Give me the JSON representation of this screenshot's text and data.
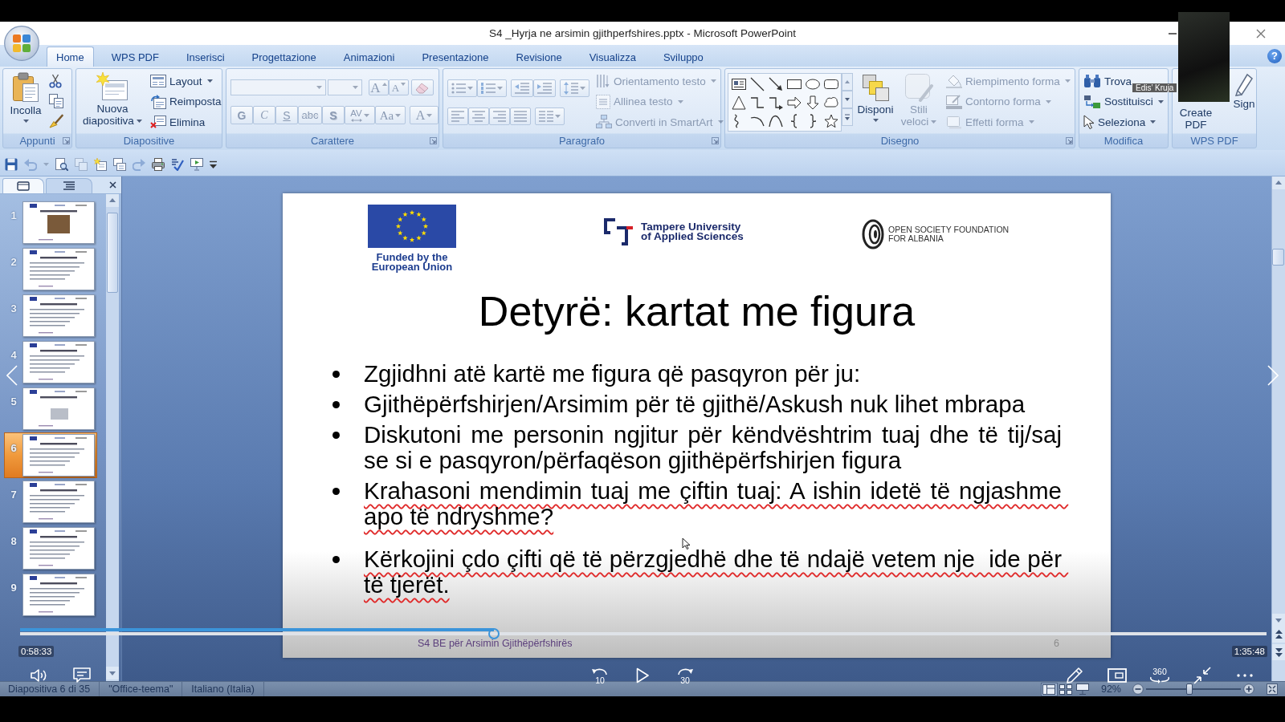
{
  "window": {
    "title": "S4 _Hyrja ne arsimin gjithperfshires.pptx - Microsoft PowerPoint"
  },
  "ribbon_tabs": [
    {
      "label": "Home",
      "selected": true
    },
    {
      "label": "WPS PDF",
      "selected": false
    },
    {
      "label": "Inserisci",
      "selected": false
    },
    {
      "label": "Progettazione",
      "selected": false
    },
    {
      "label": "Animazioni",
      "selected": false
    },
    {
      "label": "Presentazione",
      "selected": false
    },
    {
      "label": "Revisione",
      "selected": false
    },
    {
      "label": "Visualizza",
      "selected": false
    },
    {
      "label": "Sviluppo",
      "selected": false
    }
  ],
  "help_button": "?",
  "ribbon_groups": [
    {
      "label": "Appunti",
      "launcher": true,
      "disabled": false,
      "large_button": {
        "label": "Incolla",
        "dropdown": true
      }
    },
    {
      "label": "Diapositive",
      "launcher": false,
      "disabled": false,
      "large_button": {
        "label": "Nuova diapositiva",
        "dropdown": true
      },
      "buttons": [
        {
          "label": "Layout",
          "dropdown": true
        },
        {
          "label": "Reimposta",
          "dropdown": false
        },
        {
          "label": "Elimina",
          "dropdown": false
        }
      ]
    },
    {
      "label": "Carattere",
      "launcher": true,
      "disabled": true,
      "size_buttons": [
        {
          "label": "A",
          "kind": "grow"
        },
        {
          "label": "A",
          "kind": "shrink"
        }
      ],
      "format_buttons": [
        {
          "label": "G",
          "kind": "bold",
          "dropdown": false
        },
        {
          "label": "C",
          "kind": "italic",
          "dropdown": false
        },
        {
          "label": "S",
          "kind": "underline",
          "dropdown": false
        },
        {
          "label": "abc",
          "kind": "strikethrough",
          "dropdown": false
        },
        {
          "label": "S",
          "kind": "shadow",
          "dropdown": false
        },
        {
          "label": "AV",
          "kind": "spacing",
          "dropdown": true
        },
        {
          "label": "Aa",
          "kind": "case",
          "dropdown": true
        }
      ],
      "color_button": {
        "label": "A",
        "dropdown": true
      }
    },
    {
      "label": "Paragrafo",
      "launcher": true,
      "disabled": true,
      "buttons": [
        {
          "label": "Orientamento testo",
          "dropdown": true
        },
        {
          "label": "Allinea testo",
          "dropdown": true
        },
        {
          "label": "Converti in SmartArt",
          "dropdown": true
        }
      ]
    },
    {
      "label": "Disegno",
      "launcher": true,
      "disabled": false,
      "large_buttons": [
        {
          "label": "Disponi",
          "dropdown": true,
          "disabled": false
        },
        {
          "label": "Stili veloci",
          "dropdown": true,
          "disabled": true
        }
      ],
      "buttons": [
        {
          "label": "Riempimento forma",
          "dropdown": true,
          "disabled": true
        },
        {
          "label": "Contorno forma",
          "dropdown": true,
          "disabled": true
        },
        {
          "label": "Effetti forma",
          "dropdown": true,
          "disabled": true
        }
      ]
    },
    {
      "label": "Modifica",
      "launcher": false,
      "disabled": false,
      "buttons": [
        {
          "label": "Trova",
          "dropdown": false
        },
        {
          "label": "Sostituisci",
          "dropdown": true
        },
        {
          "label": "Seleziona",
          "dropdown": true
        }
      ]
    },
    {
      "label": "WPS PDF",
      "launcher": false,
      "disabled": false,
      "large_buttons": [
        {
          "label": "Create PDF",
          "dropdown": false
        },
        {
          "label": "Sign",
          "dropdown": false
        }
      ]
    }
  ],
  "quick_access": [
    {
      "disabled": false
    },
    {
      "disabled": true
    },
    {
      "disabled": true
    },
    {
      "disabled": false
    },
    {
      "disabled": true
    },
    {
      "disabled": false
    },
    {
      "disabled": false
    },
    {
      "disabled": true
    },
    {
      "disabled": false
    },
    {
      "disabled": false
    },
    {
      "disabled": false
    },
    {
      "disabled": false
    }
  ],
  "slide_panel": {
    "tabs": [
      {
        "selected": true
      },
      {
        "selected": false
      }
    ],
    "slides": [
      {
        "number": "1",
        "selected": false
      },
      {
        "number": "2",
        "selected": false
      },
      {
        "number": "3",
        "selected": false
      },
      {
        "number": "4",
        "selected": false
      },
      {
        "number": "5",
        "selected": false
      },
      {
        "number": "6",
        "selected": true
      },
      {
        "number": "7",
        "selected": false
      },
      {
        "number": "8",
        "selected": false
      },
      {
        "number": "9",
        "selected": false
      }
    ]
  },
  "slide": {
    "logos": [
      {
        "kind": "flag",
        "text": "Funded by the\nEuropean Union"
      },
      {
        "kind": "bracket",
        "text": "Tampere University\nof Applied Sciences"
      },
      {
        "kind": "spiral",
        "text": "OPEN SOCIETY FOUNDATION\nFOR ALBANIA"
      }
    ],
    "title": "Detyrë: kartat me figura",
    "bullets": [
      {
        "text": "Zgjidhni atë kartë me figura që pasqyron për ju:",
        "spelling_marked": false
      },
      {
        "text": "Gjithëpërfshirjen/Arsimim për të gjithë/Askush nuk lihet mbrapa",
        "spelling_marked": false
      },
      {
        "text": "Diskutoni me personin ngjitur për këndvështrim tuaj dhe të tij/saj se si e pasqyron/përfaqëson gjithëpërfshirjen figura",
        "spelling_marked": false
      },
      {
        "text": "Krahasoni mendimin tuaj me çiftin tuaj: A ishin idetë të ngjashme apo të ndryshme?",
        "spelling_marked": true
      },
      {
        "text": "Kërkojini çdo çifti që të përzgjedhë dhe të ndajë vetem nje  ide për të tjerët.",
        "spelling_marked": true
      }
    ],
    "footer": "S4 BE për Arsimin Gjithëpërfshirës",
    "number": "6"
  },
  "player": {
    "level": 0.38,
    "current_time": "0:58:33",
    "duration": "1:35:48",
    "rewind_label": "10",
    "forward_label": "30",
    "view_360_label": "360"
  },
  "webcam": {
    "name": "Edis’ Kruja"
  },
  "status_bar": {
    "slide_info": "Diapositiva 6 di 35",
    "theme": "\"Office-teema\"",
    "language": "Italiano (Italia)",
    "views": [
      {
        "selected": true
      },
      {
        "selected": false
      },
      {
        "selected": false
      }
    ],
    "zoom": "92%",
    "zoom_slider": {
      "level": 0.46
    }
  }
}
